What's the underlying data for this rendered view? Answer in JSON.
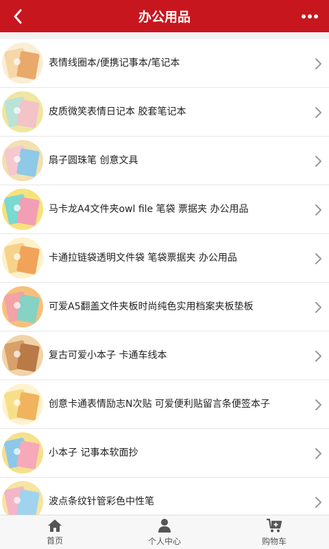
{
  "header": {
    "title": "办公用品",
    "back_icon": "chevron-left-icon",
    "more_icon": "more-dots-icon",
    "color": "#c8161e"
  },
  "products": [
    {
      "name": "表情线圈本/便携记事本/笔记本",
      "thumb_colors": [
        "#f6d7a8",
        "#e9a96b",
        "#fbeed6"
      ]
    },
    {
      "name": "皮质微笑表情日记本 胶套笔记本",
      "thumb_colors": [
        "#b9e3d6",
        "#f4c3c8",
        "#f0e6a0"
      ]
    },
    {
      "name": "扇子圆珠笔 创意文具",
      "thumb_colors": [
        "#f5c8cf",
        "#8ec9e8",
        "#f3e0b0"
      ]
    },
    {
      "name": "马卡龙A4文件夹owl file 笔袋 票据夹 办公用品",
      "thumb_colors": [
        "#7ad9d0",
        "#f29fb5",
        "#f7e27a"
      ]
    },
    {
      "name": "卡通拉链袋透明文件袋 笔袋票据夹 办公用品",
      "thumb_colors": [
        "#f6d28a",
        "#f1a35a",
        "#fff1c9"
      ]
    },
    {
      "name": "可爱A5翻盖文件夹板时尚纯色实用档案夹板垫板",
      "thumb_colors": [
        "#f3a2a6",
        "#86d2c4",
        "#f6c07c"
      ]
    },
    {
      "name": "复古可爱小本子 卡通车线本",
      "thumb_colors": [
        "#d9a06a",
        "#b97a48",
        "#f1d3a8"
      ]
    },
    {
      "name": "创意卡通表情励志N次贴 可爱便利贴留言条便签本子",
      "thumb_colors": [
        "#f7df8a",
        "#f1b45d",
        "#fff3cf"
      ]
    },
    {
      "name": "小本子 记事本软面抄",
      "thumb_colors": [
        "#8cc8ea",
        "#f6a9b8",
        "#f6e08c"
      ]
    },
    {
      "name": "波点条纹针管彩色中性笔",
      "thumb_colors": [
        "#f4b6c6",
        "#9fd3ee",
        "#f6e4a0"
      ]
    }
  ],
  "tabbar": {
    "tabs": [
      {
        "label": "首页",
        "icon": "home-icon"
      },
      {
        "label": "个人中心",
        "icon": "user-icon"
      },
      {
        "label": "购物车",
        "icon": "cart-icon"
      }
    ]
  }
}
